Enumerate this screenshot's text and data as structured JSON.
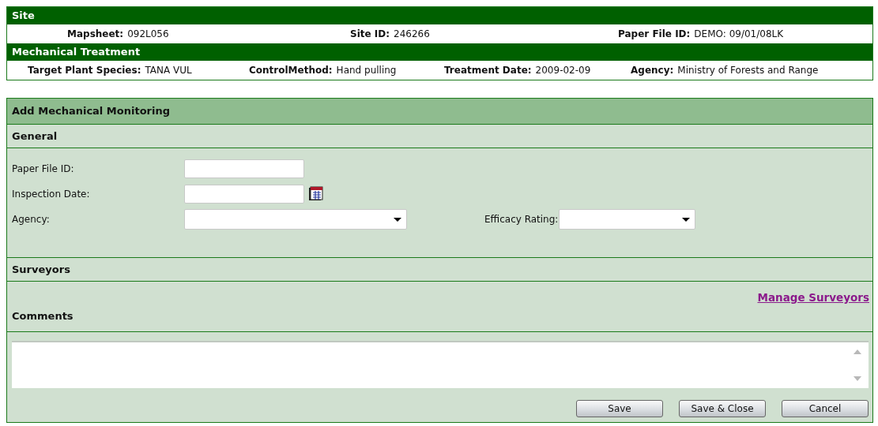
{
  "site": {
    "title": "Site",
    "fields": [
      {
        "label": "Mapsheet:",
        "value": "092L056"
      },
      {
        "label": "Site ID:",
        "value": "246266"
      },
      {
        "label": "Paper File ID:",
        "value": "DEMO: 09/01/08LK"
      }
    ]
  },
  "treatment": {
    "title": "Mechanical Treatment",
    "fields": [
      {
        "label": "Target Plant Species:",
        "value": "TANA VUL"
      },
      {
        "label": "ControlMethod:",
        "value": "Hand pulling"
      },
      {
        "label": "Treatment Date:",
        "value": "2009-02-09"
      },
      {
        "label": "Agency:",
        "value": "Ministry of Forests and Range"
      }
    ]
  },
  "form": {
    "title": "Add Mechanical Monitoring",
    "general": {
      "title": "General",
      "rows": [
        [
          {
            "label": "Paper File ID:",
            "kind": "text"
          }
        ],
        [
          {
            "label": "Inspection Date:",
            "kind": "date"
          }
        ],
        [
          {
            "label": "Agency:",
            "kind": "select"
          },
          {
            "label": "Efficacy Rating:",
            "kind": "select"
          }
        ]
      ]
    },
    "surveyors": {
      "title": "Surveyors",
      "link": "Manage Surveyors"
    },
    "comments": {
      "title": "Comments"
    },
    "buttons": [
      "Save",
      "Save & Close",
      "Cancel"
    ]
  }
}
